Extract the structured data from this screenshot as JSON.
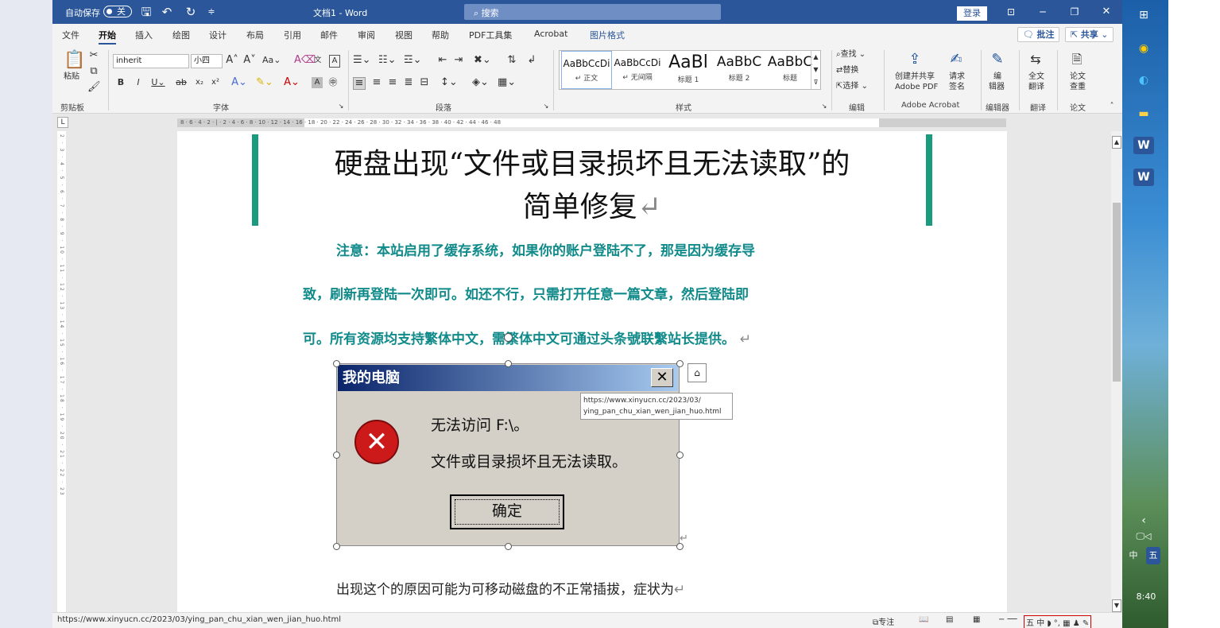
{
  "titlebar": {
    "autosave_label": "自动保存",
    "autosave_state": "关",
    "doc_title": "文档1  -  Word",
    "search_placeholder": "搜索",
    "signin": "登录",
    "icons": [
      "save-icon",
      "undo-icon",
      "redo-icon",
      "customize-icon",
      "ribbon-display-icon",
      "minimize-icon",
      "restore-icon",
      "close-icon"
    ]
  },
  "menu": {
    "tabs": [
      "文件",
      "开始",
      "插入",
      "绘图",
      "设计",
      "布局",
      "引用",
      "邮件",
      "审阅",
      "视图",
      "帮助",
      "PDF工具集",
      "Acrobat",
      "图片格式"
    ],
    "active": "开始",
    "comments": "批注",
    "share": "共享"
  },
  "ribbon": {
    "clipboard": {
      "paste": "粘贴",
      "group": "剪贴板"
    },
    "font": {
      "name": "inherit",
      "size": "小四",
      "group": "字体"
    },
    "paragraph": {
      "group": "段落"
    },
    "styles": {
      "group": "样式",
      "items": [
        {
          "preview": "AaBbCcDi",
          "name": "↵ 正文"
        },
        {
          "preview": "AaBbCcDi",
          "name": "↵ 无间隔"
        },
        {
          "preview": "AaBl",
          "name": "标题 1"
        },
        {
          "preview": "AaBbC",
          "name": "标题 2"
        },
        {
          "preview": "AaBbC",
          "name": "标题"
        }
      ]
    },
    "editing": {
      "find": "查找",
      "replace": "替换",
      "select": "选择",
      "group": "编辑"
    },
    "acrobat": {
      "create_share": "创建并共享",
      "adobe_pdf": "Adobe PDF",
      "request": "请求",
      "sign": "签名",
      "group": "Adobe Acrobat"
    },
    "editor": {
      "label1": "编",
      "label2": "辑器",
      "group": "编辑器"
    },
    "translate": {
      "label1": "全文",
      "label2": "翻译",
      "group": "翻译"
    },
    "paper": {
      "label1": "论文",
      "label2": "查重",
      "group": "论文"
    }
  },
  "ruler": {
    "text": "8 · 6 · 4 · 2 · | · 2 · 4 · 6 · 8 · 10 · 12 · 14 · 16 · 18 · 20 · 22 · 24 · 26 · 28 · 30 · 32 · 34 · 36 · 38 · 40 · 42 · 44 · 46 · 48",
    "v_text": "2 · 3 · 4 · 5 · 6 · 7 · 8 · 9 · 10 · 11 · 12 · 13 · 14 · 15 · 16 · 17 · 18 · 19 · 20 · 21 · 22 · 23"
  },
  "document": {
    "heading_line1": "硬盘出现“文件或目录损坏且无法读取”的",
    "heading_line2": "简单修复",
    "notice_line1": "注意：本站启用了缓存系统，如果你的账户登陆不了，那是因为缓存导",
    "notice_line2": "致，刷新再登陆一次即可。如还不行，只需打开任意一篇文章，然后登陆即",
    "notice_line3": "可。所有资源均支持繁体中文，需繁体中文可通过头条號联繫站长提供。",
    "para": "出现这个的原因可能为可移动磁盘的不正常插拔，症状为",
    "pilcrow": "↵",
    "tooltip_line1": "https://www.xinyucn.cc/2023/03/",
    "tooltip_line2": "ying_pan_chu_xian_wen_jian_huo.html"
  },
  "dialog": {
    "title": "我的电脑",
    "close": "✕",
    "message1": "无法访问 F:\\。",
    "message2": "文件或目录损坏且无法读取。",
    "ok": "确定"
  },
  "statusbar": {
    "url": "https://www.xinyucn.cc/2023/03/ying_pan_chu_xian_wen_jian_huo.html",
    "focus": "专注"
  },
  "taskbar": {
    "ime": "中",
    "ime2": "五",
    "time": "8:40"
  },
  "colors": {
    "word_blue": "#2b579a",
    "notice_teal": "#118a8a",
    "accent_bar": "#1a9a7f",
    "dialog_gray": "#d4d0c8"
  }
}
